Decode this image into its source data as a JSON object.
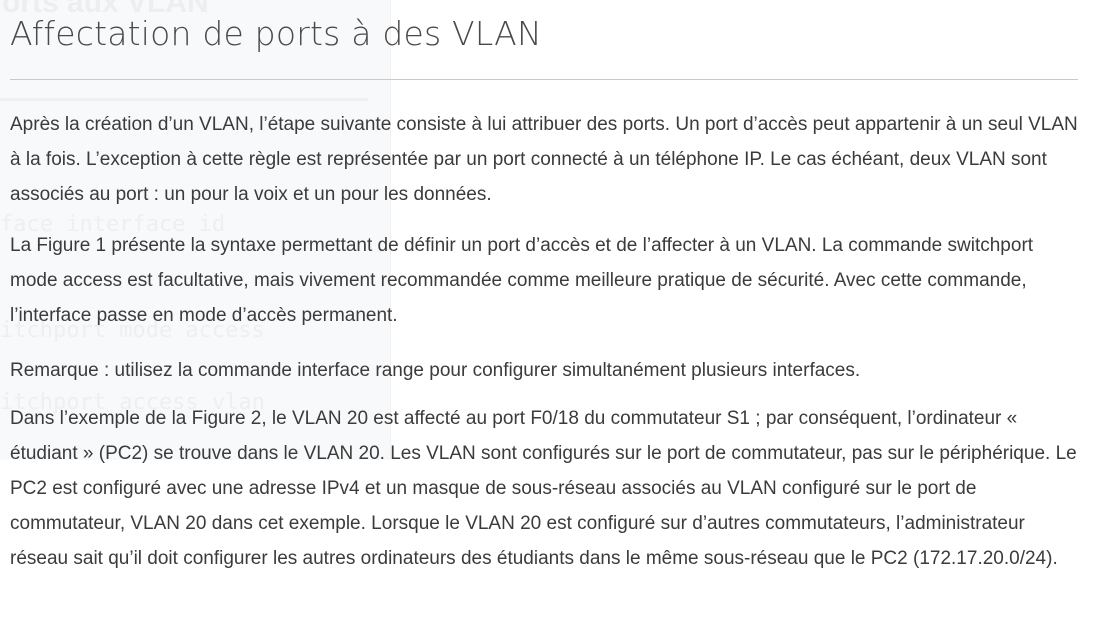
{
  "ghost": {
    "title": "orts aux VLAN",
    "code_lines": [
      "face interface id",
      "itchport mode access",
      "itchport access vlan"
    ]
  },
  "page": {
    "title": "Affectation de ports à des VLAN",
    "paragraphs": [
      "Après la création d’un VLAN, l’étape suivante consiste à lui attribuer des ports. Un port d’accès peut appartenir à un seul VLAN à la fois. L’exception à cette règle est représentée par un port connecté à un téléphone IP. Le cas échéant, deux VLAN sont associés au port : un pour la voix et un pour les données.",
      "La Figure 1 présente la syntaxe permettant de définir un port d’accès et de l’affecter à un VLAN. La commande switchport mode access est facultative, mais vivement recommandée comme meilleure pratique de sécurité. Avec cette commande, l’interface passe en mode d’accès permanent.",
      "Remarque : utilisez la commande interface range pour configurer simultanément plusieurs interfaces.",
      "Dans l’exemple de la Figure 2, le VLAN 20 est affecté au port F0/18 du commutateur S1 ; par conséquent, l’ordinateur « étudiant » (PC2) se trouve dans le VLAN 20. Les VLAN sont configurés sur le port de commutateur, pas sur le périphérique. Le PC2 est configuré avec une adresse IPv4 et un masque de sous-réseau associés au VLAN configuré sur le port de commutateur, VLAN 20 dans cet exemple. Lorsque le VLAN 20 est configuré sur d’autres commutateurs, l’administrateur réseau sait qu’il doit configurer les autres ordinateurs des étudiants dans le même sous-réseau que le PC2 (172.17.20.0/24)."
    ]
  }
}
